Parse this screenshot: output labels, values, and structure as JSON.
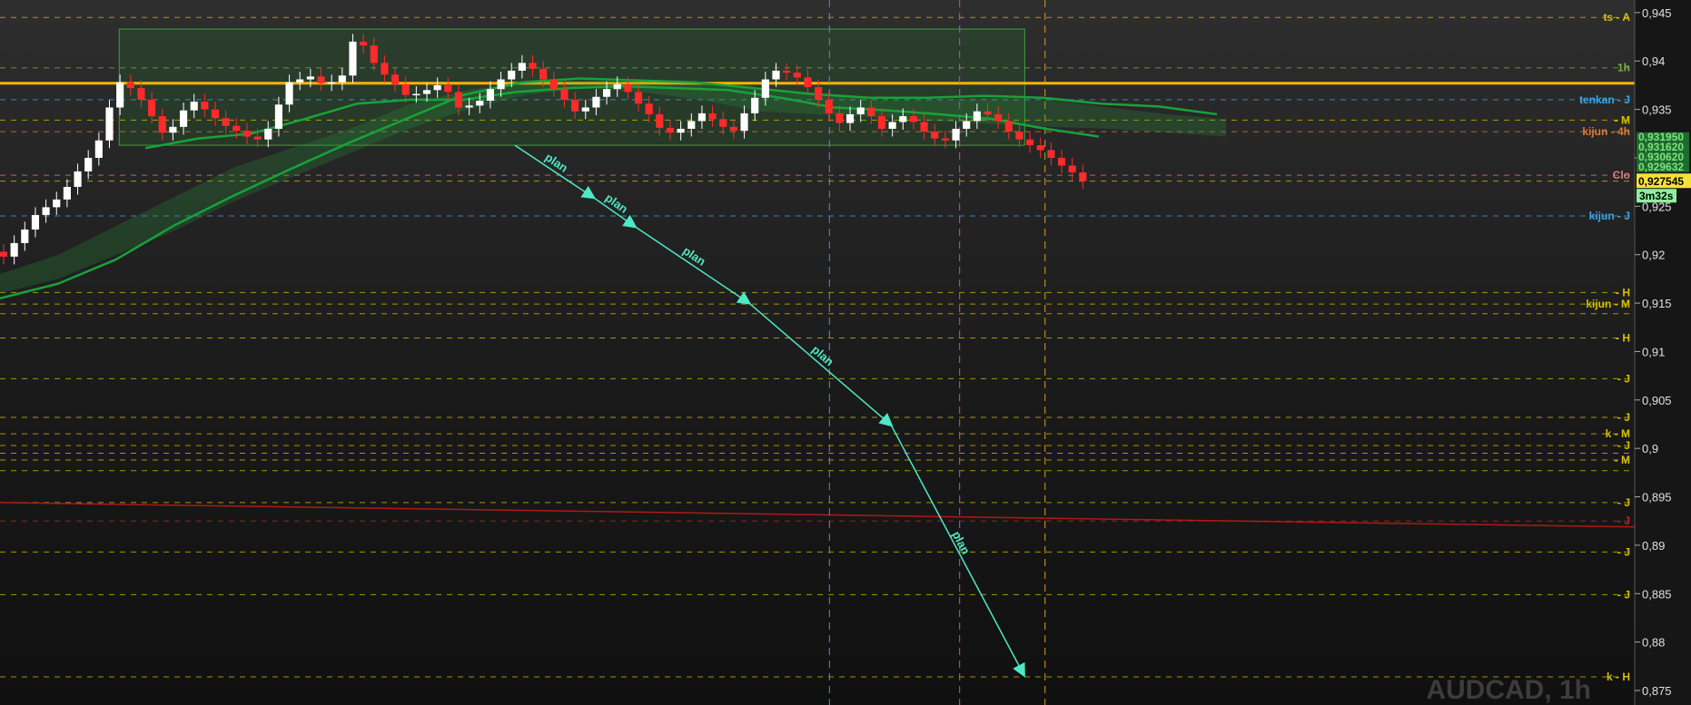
{
  "chart_data": {
    "type": "candlestick",
    "symbol": "AUDCAD",
    "timeframe": "1h",
    "watermark": "AUDCAD, 1h",
    "ylim": [
      0.8735,
      0.9463
    ],
    "yticks": [
      "0,875",
      "0,88",
      "0,885",
      "0,89",
      "0,895",
      "0,9",
      "0,905",
      "0,91",
      "0,915",
      "0,92",
      "0,925",
      "0,93",
      "0,935",
      "0,94",
      "0,945"
    ],
    "price_badge": {
      "value": "0,927545",
      "countdown": "3m32s",
      "bg": "#f5e03a"
    },
    "stacked_labels": [
      "0,931950",
      "0,931620",
      "0,930620",
      "0,929632"
    ],
    "horizontal_levels": [
      {
        "price": 0.9445,
        "label": "ts - A",
        "color": "#d4c000",
        "style": "dash"
      },
      {
        "price": 0.9393,
        "label": "1h",
        "color": "#7ab04a",
        "style": "dash"
      },
      {
        "price": 0.9377,
        "label": "",
        "color": "#ffb400",
        "style": "solid-thick"
      },
      {
        "price": 0.936,
        "label": "tenkan - J",
        "color": "#3ea6e8",
        "style": "dash"
      },
      {
        "price": 0.9339,
        "label": "- M",
        "color": "#d4c000",
        "style": "dash"
      },
      {
        "price": 0.9327,
        "label": "kijun - 4h",
        "color": "#e07a3a",
        "style": "dash"
      },
      {
        "price": 0.9282,
        "label": "Clo",
        "color": "#e07a8a",
        "style": "dash"
      },
      {
        "price": 0.9276,
        "label": "",
        "color": "#d4c000",
        "style": "dash"
      },
      {
        "price": 0.924,
        "label": "kijun - J",
        "color": "#3ea6e8",
        "style": "dash"
      },
      {
        "price": 0.9161,
        "label": "- H",
        "color": "#d4c000",
        "style": "dash"
      },
      {
        "price": 0.9149,
        "label": "kijun - M",
        "color": "#d4c000",
        "style": "dash"
      },
      {
        "price": 0.9139,
        "label": "",
        "color": "#d4c000",
        "style": "dash"
      },
      {
        "price": 0.9114,
        "label": "- H",
        "color": "#d4c000",
        "style": "dash"
      },
      {
        "price": 0.9072,
        "label": "- J",
        "color": "#d4c000",
        "style": "dash"
      },
      {
        "price": 0.9032,
        "label": "- J",
        "color": "#d4c000",
        "style": "dash"
      },
      {
        "price": 0.9015,
        "label": "k - M",
        "color": "#d4c000",
        "style": "dash"
      },
      {
        "price": 0.9003,
        "label": "- J",
        "color": "#d4c000",
        "style": "dash"
      },
      {
        "price": 0.8995,
        "label": "",
        "color": "#d4c000",
        "style": "dash"
      },
      {
        "price": 0.8988,
        "label": "- M",
        "color": "#d4c000",
        "style": "dash"
      },
      {
        "price": 0.8977,
        "label": "",
        "color": "#d4c000",
        "style": "dash"
      },
      {
        "price": 0.8944,
        "label": "- J",
        "color": "#d4c000",
        "style": "dash"
      },
      {
        "price": 0.8925,
        "label": "- J",
        "color": "#cc2222",
        "style": "dash"
      },
      {
        "price": 0.8893,
        "label": "- J",
        "color": "#d4c000",
        "style": "dash"
      },
      {
        "price": 0.8849,
        "label": "- J",
        "color": "#d4c000",
        "style": "dash"
      },
      {
        "price": 0.8764,
        "label": "k - H",
        "color": "#d4c000",
        "style": "dash"
      }
    ],
    "trendline": {
      "p1": 0.8944,
      "p2": 0.8918,
      "color": "#b01818"
    },
    "vertical_markers": [
      {
        "x_frac": 0.4905,
        "color": "#5a8ad8"
      },
      {
        "x_frac": 0.5675,
        "color": "#c050c0"
      },
      {
        "x_frac": 0.618,
        "color": "#d4a020"
      }
    ],
    "range_box": {
      "x0_frac": 0.0705,
      "x1_frac": 0.606,
      "top": 0.9433,
      "bottom": 0.9313
    },
    "plan_path": {
      "label": "plan",
      "points": [
        {
          "x_frac": 0.3045,
          "p": 0.9313
        },
        {
          "x_frac": 0.351,
          "p": 0.9259
        },
        {
          "x_frac": 0.3755,
          "p": 0.9229
        },
        {
          "x_frac": 0.443,
          "p": 0.915
        },
        {
          "x_frac": 0.527,
          "p": 0.9024
        },
        {
          "x_frac": 0.6055,
          "p": 0.8766
        }
      ]
    },
    "series_closes": [
      0.9198,
      0.9212,
      0.9226,
      0.9241,
      0.9249,
      0.9257,
      0.927,
      0.9286,
      0.93,
      0.9318,
      0.9352,
      0.9378,
      0.9372,
      0.936,
      0.9343,
      0.9326,
      0.9332,
      0.9349,
      0.9358,
      0.935,
      0.9341,
      0.9333,
      0.9328,
      0.9322,
      0.9319,
      0.933,
      0.9355,
      0.9378,
      0.9381,
      0.9384,
      0.9377,
      0.9378,
      0.9385,
      0.942,
      0.9416,
      0.9398,
      0.9386,
      0.9376,
      0.9365,
      0.9366,
      0.937,
      0.9375,
      0.9368,
      0.9352,
      0.9354,
      0.9359,
      0.9371,
      0.9381,
      0.939,
      0.9398,
      0.9392,
      0.9381,
      0.9371,
      0.936,
      0.9348,
      0.9352,
      0.9363,
      0.9371,
      0.9376,
      0.9368,
      0.9356,
      0.9345,
      0.9331,
      0.9326,
      0.933,
      0.9338,
      0.9346,
      0.934,
      0.9332,
      0.9328,
      0.9346,
      0.9362,
      0.9381,
      0.939,
      0.9388,
      0.9383,
      0.9373,
      0.936,
      0.9346,
      0.9336,
      0.9345,
      0.9352,
      0.9343,
      0.933,
      0.9337,
      0.9343,
      0.9337,
      0.9327,
      0.932,
      0.9318,
      0.933,
      0.9338,
      0.9348,
      0.9345,
      0.9338,
      0.9327,
      0.9319,
      0.9313,
      0.9308,
      0.93,
      0.9292,
      0.9285,
      0.9276
    ],
    "kumo_a": [
      0.918,
      0.92,
      0.923,
      0.926,
      0.929,
      0.931,
      0.933,
      0.9355,
      0.937,
      0.9378,
      0.938,
      0.9378,
      0.9377,
      0.937,
      0.9365,
      0.936,
      0.936,
      0.9362,
      0.936,
      0.9352,
      0.9345,
      0.934
    ],
    "kumo_b": [
      0.916,
      0.9175,
      0.92,
      0.9225,
      0.9255,
      0.928,
      0.9305,
      0.933,
      0.935,
      0.9365,
      0.9372,
      0.9368,
      0.936,
      0.9348,
      0.9345,
      0.9342,
      0.9338,
      0.9335,
      0.9332,
      0.933,
      0.9326,
      0.9322
    ],
    "green_line_a": [
      0.9155,
      0.917,
      0.9195,
      0.923,
      0.926,
      0.9288,
      0.9315,
      0.934,
      0.9365,
      0.9378,
      0.9382,
      0.938,
      0.9378,
      0.9372,
      0.9366,
      0.9362,
      0.9362,
      0.9364,
      0.9362,
      0.9356,
      0.9353,
      0.9345
    ],
    "green_line_b": [
      0.931,
      0.932,
      0.9325,
      0.934,
      0.9356,
      0.936,
      0.936,
      0.9368,
      0.9372,
      0.9374,
      0.9372,
      0.937,
      0.9362,
      0.9352,
      0.9349,
      0.9345,
      0.934,
      0.933,
      0.9322
    ]
  }
}
